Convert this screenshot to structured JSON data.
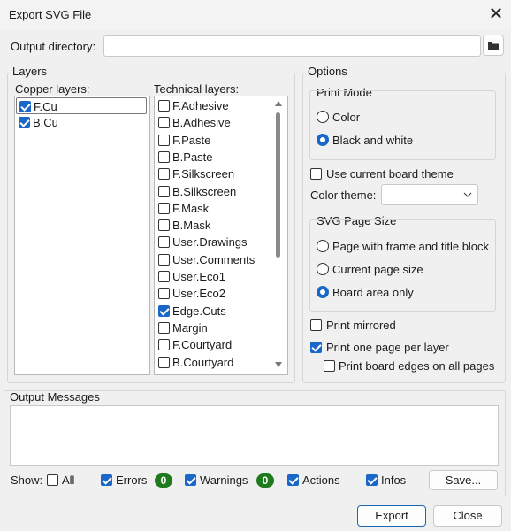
{
  "window": {
    "title": "Export SVG File"
  },
  "output": {
    "directory_label": "Output directory:",
    "directory_value": "",
    "folder_icon": "folder-icon"
  },
  "layers": {
    "group_title": "Layers",
    "copper_title": "Copper layers:",
    "copper": [
      {
        "name": "F.Cu",
        "checked": true
      },
      {
        "name": "B.Cu",
        "checked": true
      }
    ],
    "technical_title": "Technical layers:",
    "technical": [
      {
        "name": "F.Adhesive",
        "checked": false
      },
      {
        "name": "B.Adhesive",
        "checked": false
      },
      {
        "name": "F.Paste",
        "checked": false
      },
      {
        "name": "B.Paste",
        "checked": false
      },
      {
        "name": "F.Silkscreen",
        "checked": false
      },
      {
        "name": "B.Silkscreen",
        "checked": false
      },
      {
        "name": "F.Mask",
        "checked": false
      },
      {
        "name": "B.Mask",
        "checked": false
      },
      {
        "name": "User.Drawings",
        "checked": false
      },
      {
        "name": "User.Comments",
        "checked": false
      },
      {
        "name": "User.Eco1",
        "checked": false
      },
      {
        "name": "User.Eco2",
        "checked": false
      },
      {
        "name": "Edge.Cuts",
        "checked": true
      },
      {
        "name": "Margin",
        "checked": false
      },
      {
        "name": "F.Courtyard",
        "checked": false
      },
      {
        "name": "B.Courtyard",
        "checked": false
      }
    ]
  },
  "options": {
    "group_title": "Options",
    "print_mode": {
      "title": "Print Mode",
      "color": "Color",
      "bw": "Black and white",
      "selected": "bw"
    },
    "use_board_theme": "Use current board theme",
    "color_theme_label": "Color theme:",
    "color_theme_value": "",
    "page_size": {
      "title": "SVG Page Size",
      "frame": "Page with frame and title block",
      "current": "Current page size",
      "board": "Board area only",
      "selected": "board"
    },
    "print_mirrored": "Print mirrored",
    "one_page_per_layer": "Print one page per layer",
    "board_edges_all_pages": "Print board edges on all pages"
  },
  "messages": {
    "title": "Output Messages",
    "show_label": "Show:",
    "all": "All",
    "errors": "Errors",
    "errors_count": "0",
    "warnings": "Warnings",
    "warnings_count": "0",
    "actions": "Actions",
    "infos": "Infos",
    "save": "Save..."
  },
  "footer": {
    "export": "Export",
    "close": "Close"
  },
  "colors": {
    "accent": "#1a67c8",
    "badge": "#1d7a1d"
  }
}
